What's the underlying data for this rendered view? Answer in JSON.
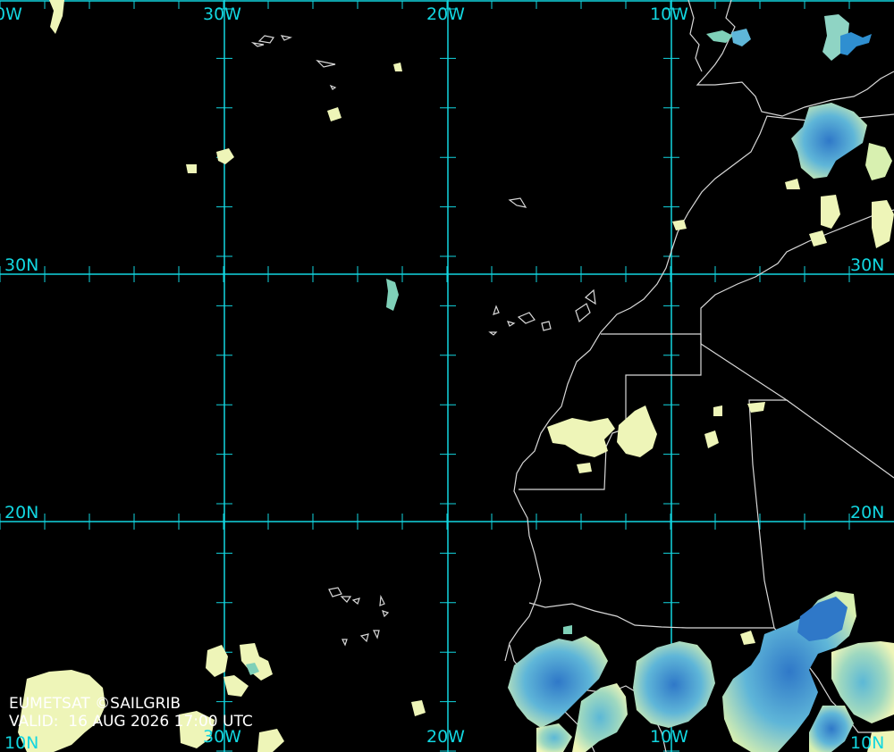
{
  "map": {
    "grid_labels": {
      "lon_top_left_partial": "0W",
      "lon_30w_top": "30W",
      "lon_20w_top": "20W",
      "lon_10w_top": "10W",
      "lat_30n_left": "30N",
      "lat_30n_right": "30N",
      "lat_20n_left": "20N",
      "lat_20n_right": "20N",
      "lat_10n_left": "10N",
      "lon_30w_bottom": "30W",
      "lon_20w_bottom": "20W",
      "lon_10w_bottom": "10W",
      "lat_10n_right": "10N"
    },
    "caption": {
      "source": "EUMETSAT ©SAILGRIB",
      "valid": "VALID:  16 AUG 2026 17:00 UTC"
    },
    "colors": {
      "grid": "#12d6e0",
      "coastline": "#d8d8d8",
      "cloud_low": "#f3f7b8",
      "cloud_mid": "#7fd0b8",
      "cloud_high": "#2f8fd0"
    }
  }
}
